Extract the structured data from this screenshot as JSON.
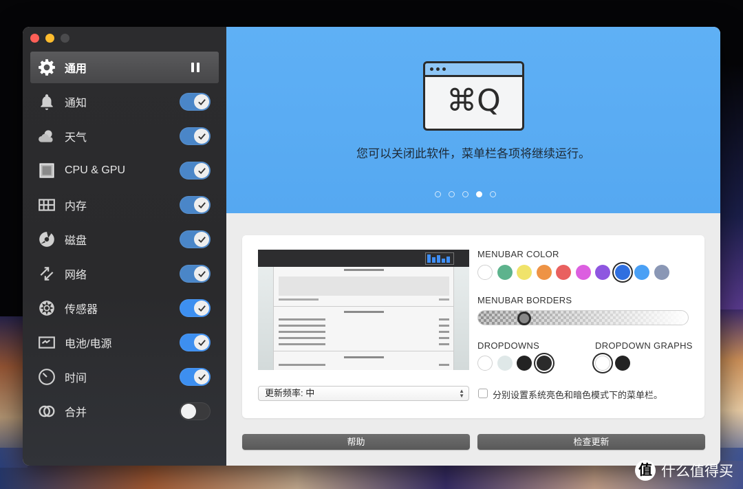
{
  "sidebar": {
    "items": [
      {
        "label": "通用",
        "icon": "gear-icon",
        "active": true,
        "control": "pause"
      },
      {
        "label": "通知",
        "icon": "bell-icon",
        "toggle": "on"
      },
      {
        "label": "天气",
        "icon": "weather-icon",
        "toggle": "on"
      },
      {
        "label": "CPU & GPU",
        "icon": "cpu-icon",
        "toggle": "on"
      },
      {
        "label": "内存",
        "icon": "memory-icon",
        "toggle": "on"
      },
      {
        "label": "磁盘",
        "icon": "disk-icon",
        "toggle": "on"
      },
      {
        "label": "网络",
        "icon": "network-arrows-icon",
        "toggle": "on"
      },
      {
        "label": "传感器",
        "icon": "fan-icon",
        "toggle": "on"
      },
      {
        "label": "电池/电源",
        "icon": "battery-icon",
        "toggle": "on"
      },
      {
        "label": "时间",
        "icon": "clock-icon",
        "toggle": "on"
      },
      {
        "label": "合并",
        "icon": "merge-rings-icon",
        "toggle": "off"
      }
    ]
  },
  "hero": {
    "shortcut": "⌘Q",
    "message": "您可以关闭此软件，菜单栏各项将继续运行。",
    "page_count": 5,
    "current_page": 4
  },
  "settings": {
    "menubar_color_label": "MENUBAR COLOR",
    "menubar_colors": [
      "#ffffff",
      "#5db38d",
      "#f0e36a",
      "#ee9345",
      "#e9605f",
      "#dc5fe0",
      "#8e56e0",
      "#2f6fe0",
      "#4aa0f5",
      "#8a97b5"
    ],
    "menubar_color_selected": 7,
    "menubar_borders_label": "MENUBAR BORDERS",
    "menubar_borders_value": 0.2,
    "dropdowns_label": "DROPDOWNS",
    "dropdowns": [
      "#ffffff",
      "#dfe8e8",
      "#232323",
      "#2b2b2b"
    ],
    "dropdowns_selected": 3,
    "dropdown_graphs_label": "DROPDOWN GRAPHS",
    "dropdown_graphs": [
      "#ffffff",
      "#232323"
    ],
    "dropdown_graphs_selected": 0,
    "update_frequency": "更新频率: 中",
    "separate_modes_label": "分别设置系统亮色和暗色模式下的菜单栏。",
    "separate_modes_checked": false
  },
  "buttons": {
    "help": "帮助",
    "check_updates": "检查更新"
  },
  "watermark": {
    "logo": "值",
    "text": "什么值得买"
  }
}
